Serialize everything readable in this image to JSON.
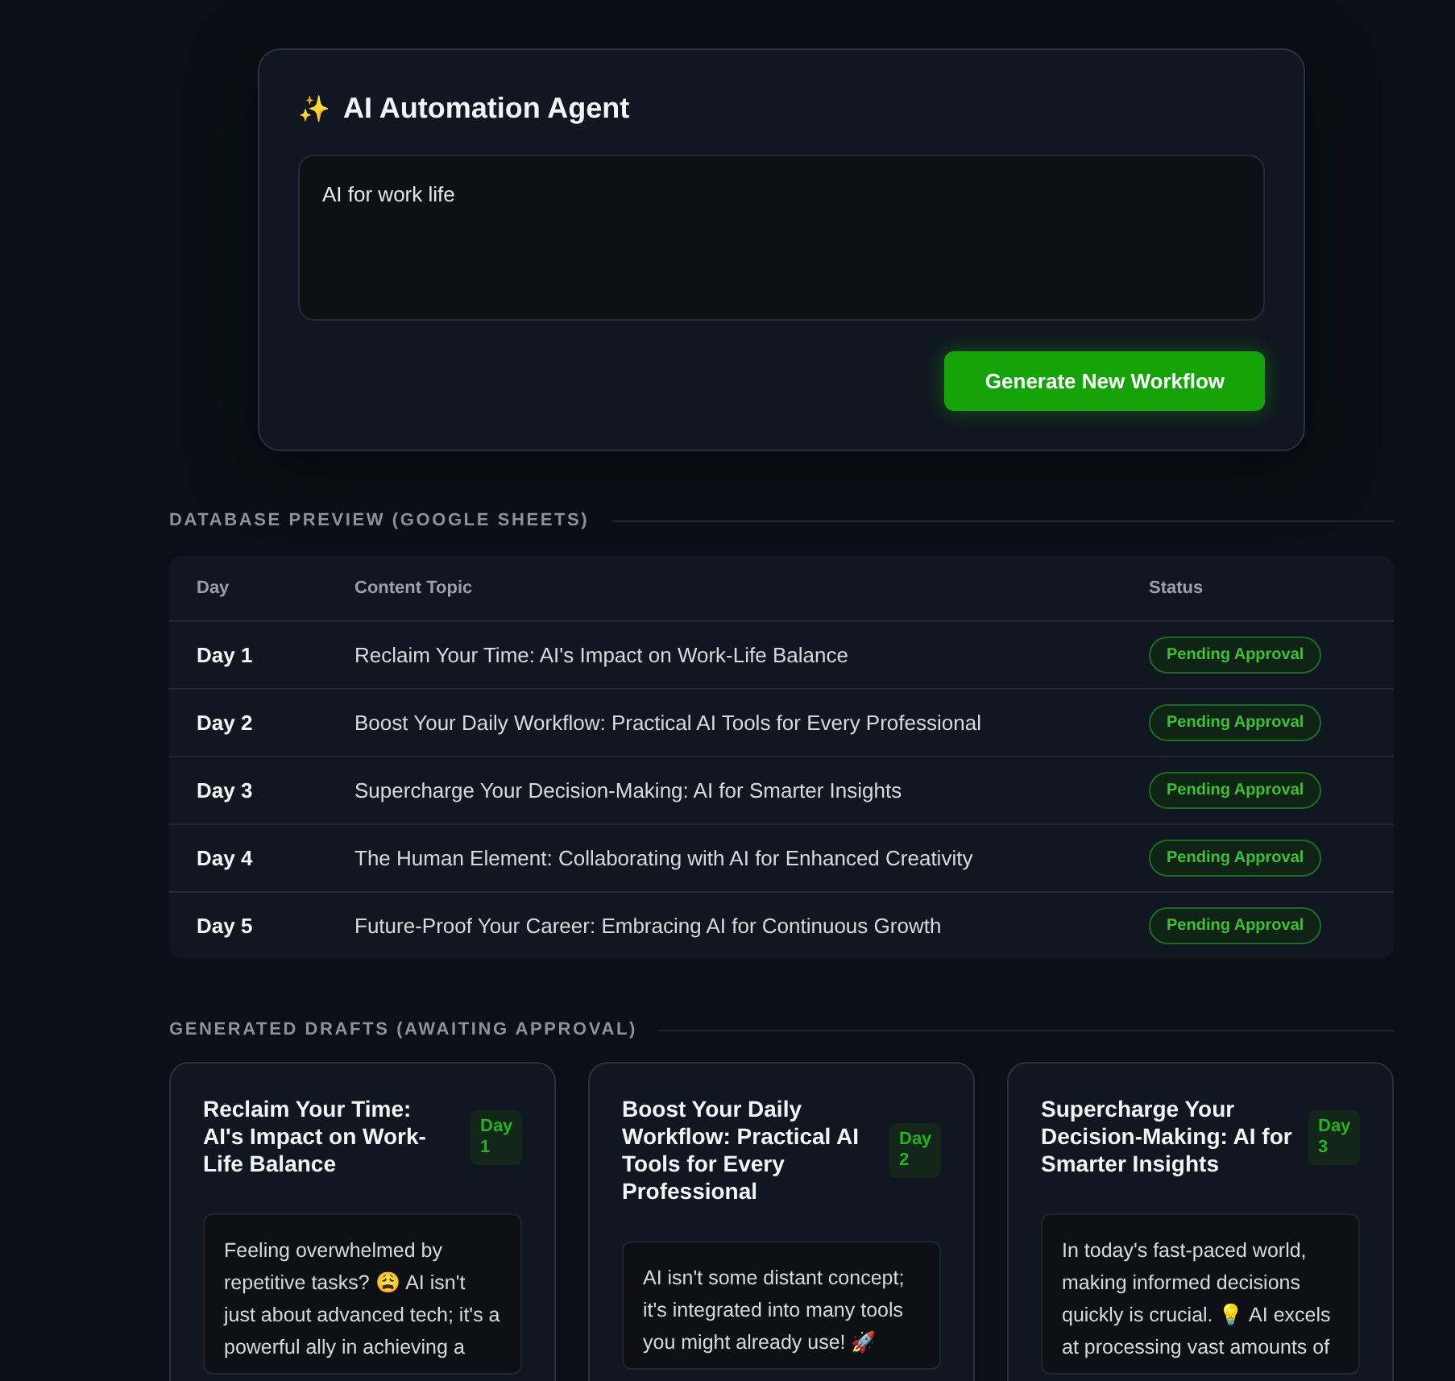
{
  "agent": {
    "icon": "✨",
    "title": "AI Automation Agent",
    "prompt": "AI for work life",
    "button": "Generate New Workflow"
  },
  "database": {
    "heading": "DATABASE PREVIEW (GOOGLE SHEETS)",
    "columns": [
      "Day",
      "Content Topic",
      "Status"
    ],
    "rows": [
      {
        "day": "Day 1",
        "topic": "Reclaim Your Time: AI's Impact on Work-Life Balance",
        "status": "Pending Approval"
      },
      {
        "day": "Day 2",
        "topic": "Boost Your Daily Workflow: Practical AI Tools for Every Professional",
        "status": "Pending Approval"
      },
      {
        "day": "Day 3",
        "topic": "Supercharge Your Decision-Making: AI for Smarter Insights",
        "status": "Pending Approval"
      },
      {
        "day": "Day 4",
        "topic": "The Human Element: Collaborating with AI for Enhanced Creativity",
        "status": "Pending Approval"
      },
      {
        "day": "Day 5",
        "topic": "Future-Proof Your Career: Embracing AI for Continuous Growth",
        "status": "Pending Approval"
      }
    ]
  },
  "drafts": {
    "heading": "GENERATED DRAFTS (AWAITING APPROVAL)",
    "cards": [
      {
        "title": "Reclaim Your Time: AI's Impact on Work-Life Balance",
        "badge": "Day 1",
        "body": "Feeling overwhelmed by repetitive tasks? 😩 AI isn't just about advanced tech; it's a powerful ally in achieving a"
      },
      {
        "title": "Boost Your Daily Workflow: Practical AI Tools for Every Professional",
        "badge": "Day 2",
        "body": "AI isn't some distant concept; it's integrated into many tools you might already use! 🚀"
      },
      {
        "title": "Supercharge Your Decision-Making: AI for Smarter Insights",
        "badge": "Day 3",
        "body": "In today's fast-paced world, making informed decisions quickly is crucial. 💡 AI excels at processing vast amounts of"
      }
    ]
  }
}
